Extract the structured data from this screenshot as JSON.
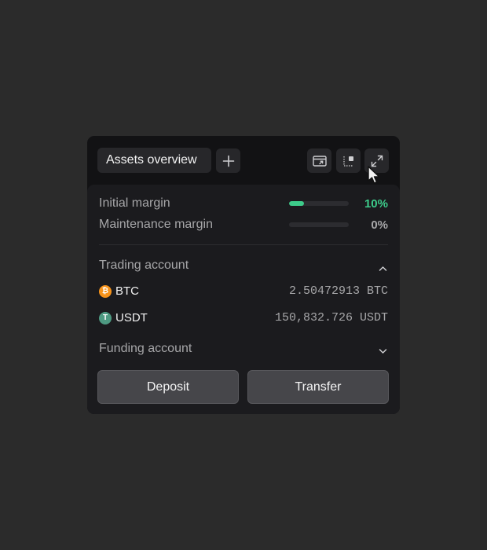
{
  "header": {
    "tab_label": "Assets overview",
    "icons": [
      "add-icon",
      "window-icon",
      "dock-icon",
      "expand-icon"
    ]
  },
  "margins": [
    {
      "label": "Initial margin",
      "percent_text": "10%",
      "fill_fraction": 0.25,
      "color": "#3dcb8a"
    },
    {
      "label": "Maintenance margin",
      "percent_text": "0%",
      "fill_fraction": 0.0,
      "color": "#a6a6a8"
    }
  ],
  "trading_account": {
    "title": "Trading account",
    "expanded": true,
    "assets": [
      {
        "symbol": "BTC",
        "coin_glyph": "₿",
        "coin_color": "#f7931a",
        "amount": "2.50472913 BTC"
      },
      {
        "symbol": "USDT",
        "coin_glyph": "T",
        "coin_color": "#4e9a82",
        "amount": "150,832.726 USDT"
      }
    ]
  },
  "funding_account": {
    "title": "Funding account",
    "expanded": false
  },
  "actions": {
    "deposit_label": "Deposit",
    "transfer_label": "Transfer"
  }
}
